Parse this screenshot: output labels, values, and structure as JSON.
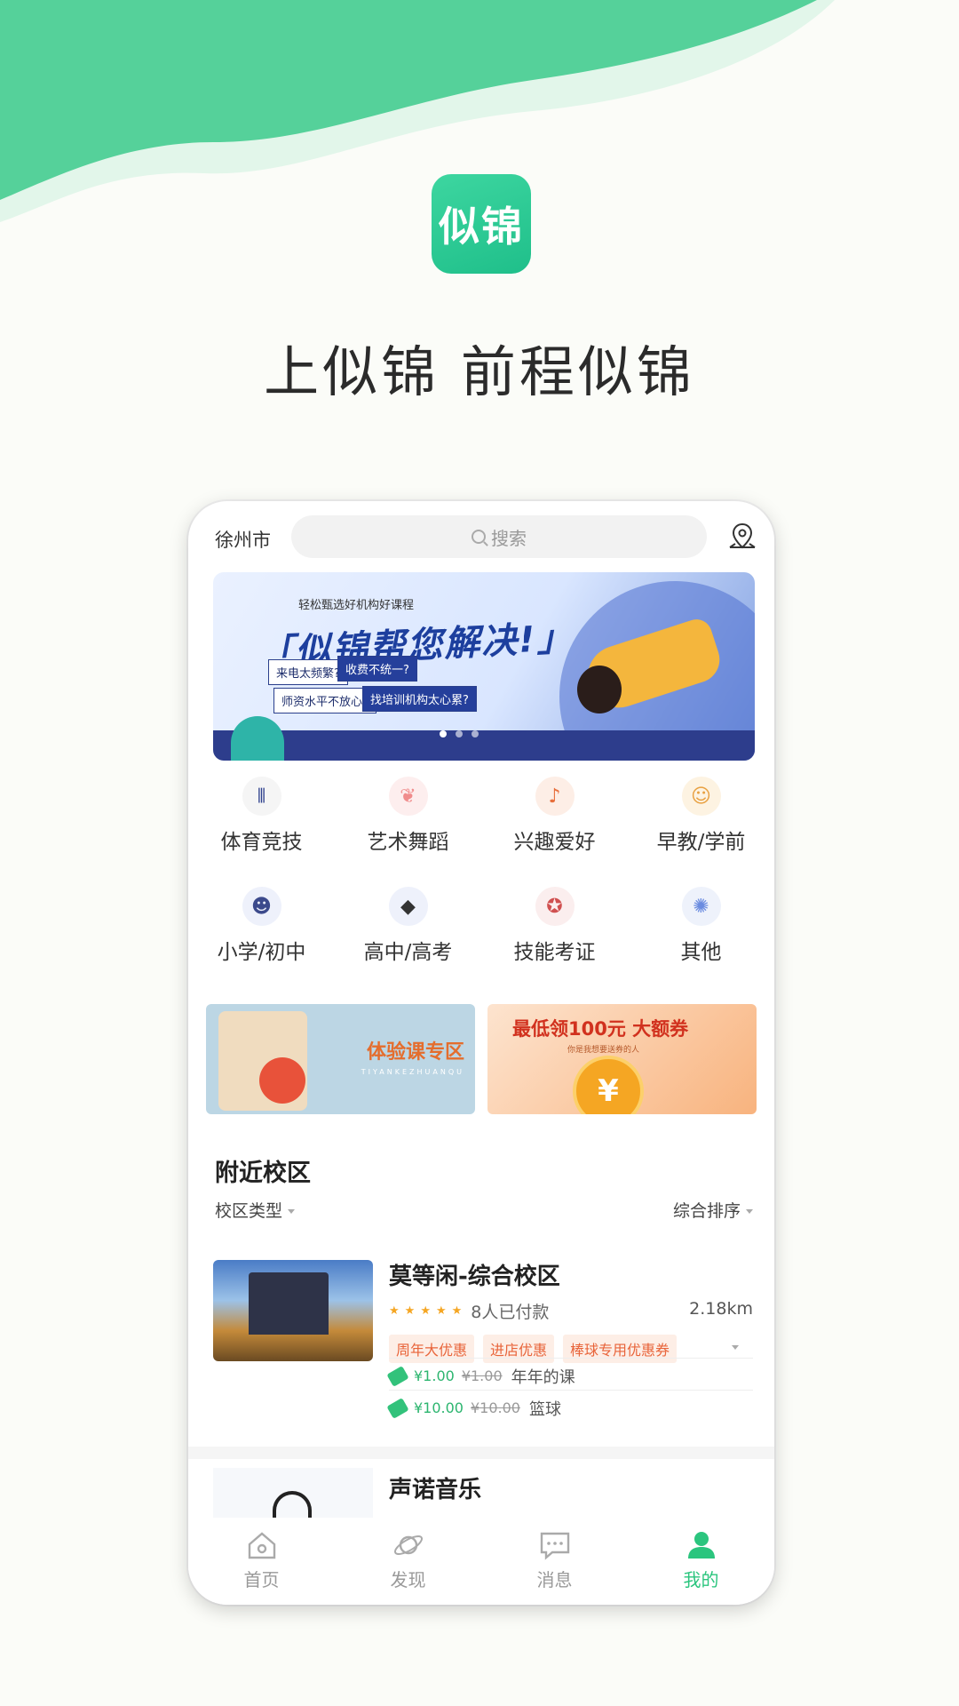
{
  "colors": {
    "accent": "#2bc57e",
    "wave_dark": "#4fcf95",
    "wave_light": "#e2f6ea",
    "price_green": "#2cb56f",
    "tag_orange": "#e8643a"
  },
  "app_logo": {
    "text": "似锦"
  },
  "slogan": "上似锦 前程似锦",
  "phone": {
    "city": "徐州市",
    "search": {
      "placeholder": "搜索",
      "icon": "search-icon"
    },
    "location_icon": "map-pin-icon",
    "banner": {
      "subtitle": "轻松甄选好机构好课程",
      "headline": "「似锦帮您解决!」",
      "notes": [
        "来电太频繁?",
        "收费不统一?",
        "师资水平不放心?",
        "找培训机构太心累?"
      ],
      "active_dot": 0,
      "dot_count": 3
    },
    "categories": [
      {
        "label": "体育竞技",
        "icon": "sports-icon"
      },
      {
        "label": "艺术舞蹈",
        "icon": "ballet-shoes-icon"
      },
      {
        "label": "兴趣爱好",
        "icon": "guitar-icon"
      },
      {
        "label": "早教/学前",
        "icon": "baby-icon"
      },
      {
        "label": "小学/初中",
        "icon": "student-icon"
      },
      {
        "label": "高中/高考",
        "icon": "graduation-cap-icon"
      },
      {
        "label": "技能考证",
        "icon": "certificate-icon"
      },
      {
        "label": "其他",
        "icon": "other-icon"
      }
    ],
    "promos": [
      {
        "title": "体验课专区",
        "subtitle": "TIYANKEZHUANQU"
      },
      {
        "title": "最低领100元 大额券",
        "subtitle": "你是我想要送券的人",
        "coin": "¥"
      }
    ],
    "nearby": {
      "title": "附近校区",
      "filter_left": "校区类型",
      "filter_right": "综合排序",
      "schools": [
        {
          "name": "莫等闲-综合校区",
          "rating": 5,
          "paid": "8人已付款",
          "distance": "2.18km",
          "tags": [
            "周年大优惠",
            "进店优惠",
            "棒球专用优惠券"
          ],
          "offers": [
            {
              "price": "¥1.00",
              "original": "¥1.00",
              "course": "年年的课"
            },
            {
              "price": "¥10.00",
              "original": "¥10.00",
              "course": "篮球"
            }
          ]
        },
        {
          "name": "声诺音乐"
        }
      ]
    },
    "tabs": [
      {
        "label": "首页",
        "icon": "home-icon",
        "active": false
      },
      {
        "label": "发现",
        "icon": "planet-icon",
        "active": false
      },
      {
        "label": "消息",
        "icon": "message-icon",
        "active": false
      },
      {
        "label": "我的",
        "icon": "user-icon",
        "active": true
      }
    ]
  }
}
